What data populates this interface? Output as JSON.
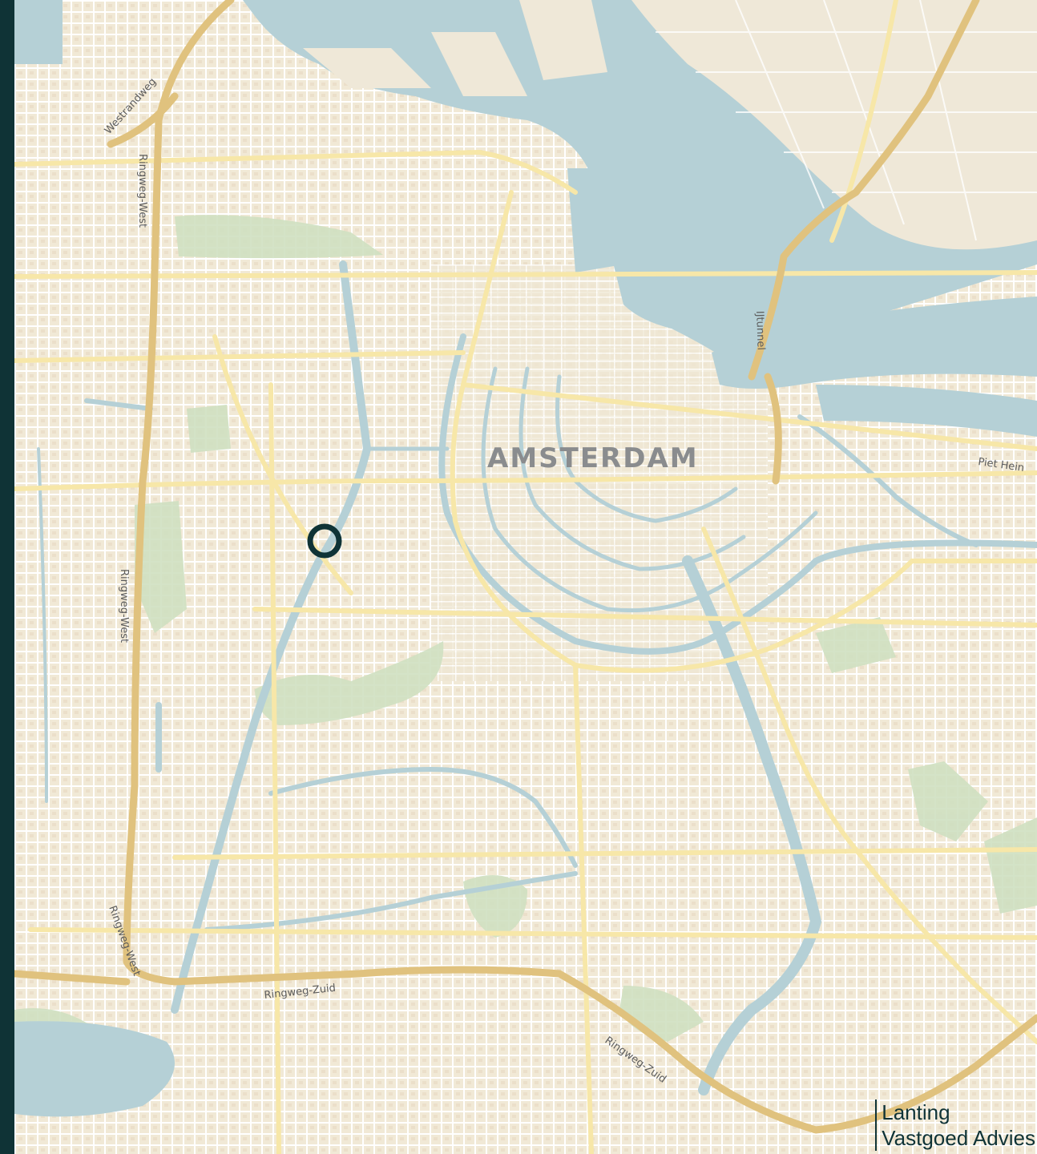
{
  "map": {
    "city_label": "AMSTERDAM",
    "road_labels": [
      "Westrandweg",
      "Ringweg-West",
      "Ringweg-West",
      "Ringweg-West",
      "Ringweg-Zuid",
      "Ringweg-Zuid",
      "IJtunnel",
      "Piet Hein"
    ],
    "marker": {
      "type": "location-ring",
      "color": "#0f3336"
    }
  },
  "brand": {
    "line1": "Lanting",
    "line2": "Vastgoed Advies"
  },
  "colors": {
    "sidebar": "#0f3336",
    "land": "#f2ecdc",
    "water": "#b5d0d6",
    "park": "#cfe0c1",
    "minor_street": "#ffffff",
    "major_road": "#f7e7a8",
    "highway": "#e0c27e"
  }
}
